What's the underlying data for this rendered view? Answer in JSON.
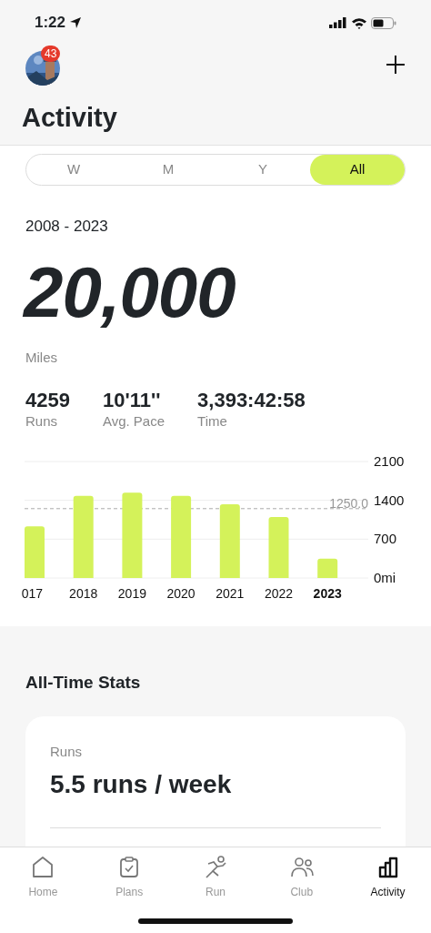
{
  "status_bar": {
    "time": "1:22"
  },
  "header": {
    "notification_count": "43",
    "title": "Activity"
  },
  "period_tabs": [
    {
      "label": "W",
      "selected": false
    },
    {
      "label": "M",
      "selected": false
    },
    {
      "label": "Y",
      "selected": false
    },
    {
      "label": "All",
      "selected": true
    }
  ],
  "summary": {
    "range": "2008 - 2023",
    "total": "20,000",
    "unit": "Miles",
    "stats": [
      {
        "value": "4259",
        "label": "Runs"
      },
      {
        "value": "10'11''",
        "label": "Avg. Pace"
      },
      {
        "value": "3,393:42:58",
        "label": "Time"
      }
    ]
  },
  "chart": {
    "chart_data": {
      "type": "bar",
      "categories": [
        "017",
        "2018",
        "2019",
        "2020",
        "2021",
        "2022",
        "2023"
      ],
      "values": [
        930,
        1480,
        1540,
        1480,
        1330,
        1100,
        350
      ],
      "ylim": [
        0,
        2100
      ],
      "yticks": [
        {
          "value": 0,
          "label": "0mi"
        },
        700,
        1400,
        2100
      ],
      "ref_lines": [
        {
          "value": 1250,
          "label": "1250.0",
          "axis": "y"
        }
      ]
    }
  },
  "all_time_stats": {
    "title": "All-Time Stats",
    "items": [
      {
        "label": "Runs",
        "value": "5.5 runs / week"
      }
    ]
  },
  "tab_bar": [
    {
      "kind": "home",
      "label": "Home",
      "selected": false
    },
    {
      "kind": "plans",
      "label": "Plans",
      "selected": false
    },
    {
      "kind": "run",
      "label": "Run",
      "selected": false
    },
    {
      "kind": "club",
      "label": "Club",
      "selected": false
    },
    {
      "kind": "activity",
      "label": "Activity",
      "selected": true
    }
  ]
}
